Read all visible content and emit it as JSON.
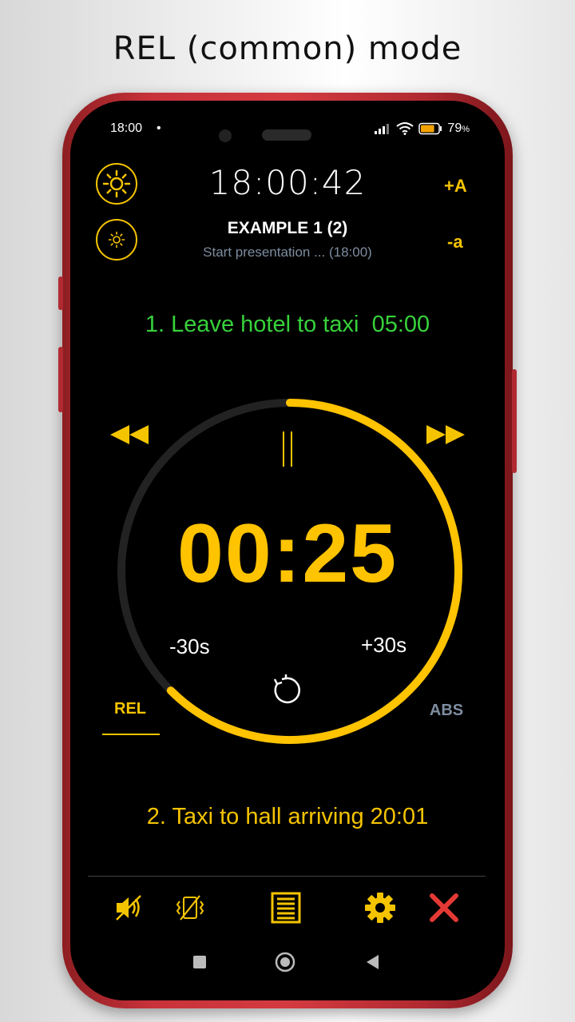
{
  "headline": "REL (common) mode",
  "status_bar": {
    "time": "18:00",
    "indicator": "•",
    "battery_percent": "79",
    "battery_unit": "%",
    "battery_fill": 0.79,
    "icons": [
      "signal-icon",
      "wifi-icon",
      "battery-icon"
    ]
  },
  "header": {
    "clock": "18:00:42",
    "font_increase": "+A",
    "font_decrease": "-a",
    "brightness_up_icon": "sun-large-icon",
    "brightness_down_icon": "sun-small-icon"
  },
  "preset": {
    "title": "EXAMPLE 1 (2)",
    "subtitle": "Start presentation ... (18:00)"
  },
  "current_step": {
    "label": "1. Leave hotel to taxi",
    "duration": "05:00"
  },
  "timer": {
    "display": "00:25",
    "progress_fraction": 0.625,
    "minus_label": "-30s",
    "plus_label": "+30s",
    "rewind_icon": "rewind-icon",
    "forward_icon": "fast-forward-icon",
    "pause_icon": "pause-icon",
    "reset_icon": "reset-icon"
  },
  "modes": {
    "rel": "REL",
    "abs": "ABS",
    "active": "REL"
  },
  "next_step": {
    "label": "2. Taxi to hall arriving 20:01"
  },
  "toolbar": {
    "icons": [
      "sound-off-icon",
      "vibration-off-icon",
      "list-icon",
      "gear-icon",
      "close-icon"
    ]
  },
  "colors": {
    "accent": "#f5c400",
    "timer": "#ffc300",
    "current_step": "#37d23b",
    "inactive": "#7d8da0",
    "close": "#e53935",
    "ring_track": "#222222"
  }
}
